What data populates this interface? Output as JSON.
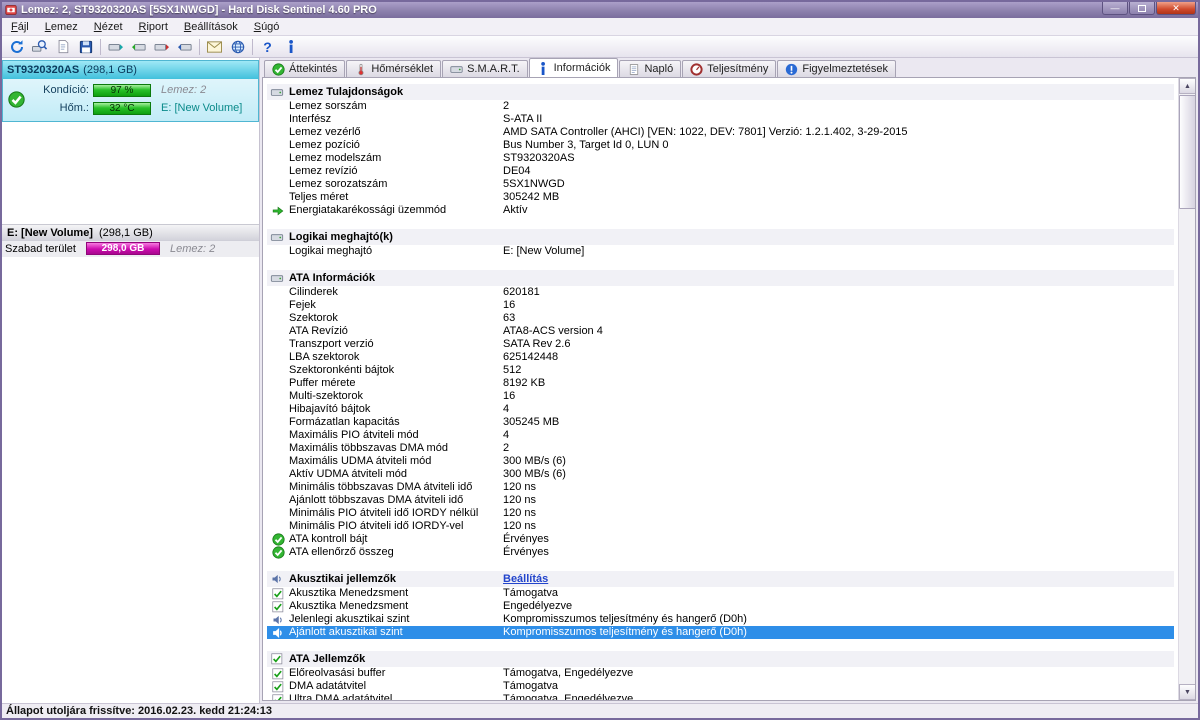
{
  "window": {
    "title": "Lemez: 2, ST9320320AS [5SX1NWGD] -  Hard Disk Sentinel 4.60 PRO",
    "status": "Állapot utoljára frissítve: 2016.02.23. kedd 21:24:13"
  },
  "menu": {
    "items": [
      "Fájl",
      "Lemez",
      "Nézet",
      "Riport",
      "Beállítások",
      "Súgó"
    ]
  },
  "toolbar": {
    "items": [
      {
        "name": "refresh-icon",
        "icon": "refresh"
      },
      {
        "name": "quick-test-icon",
        "icon": "magnifier"
      },
      {
        "name": "report-icon",
        "icon": "page"
      },
      {
        "name": "save-icon",
        "icon": "save"
      },
      {
        "sep": true
      },
      {
        "name": "first-disk-icon",
        "icon": "disk-teal"
      },
      {
        "name": "prev-disk-icon",
        "icon": "disk-green"
      },
      {
        "name": "next-disk-icon",
        "icon": "disk-red"
      },
      {
        "name": "last-disk-icon",
        "icon": "disk-blue"
      },
      {
        "sep": true
      },
      {
        "name": "send-mail-icon",
        "icon": "mail"
      },
      {
        "name": "website-icon",
        "icon": "globe"
      },
      {
        "sep": true
      },
      {
        "name": "help-icon",
        "icon": "help"
      },
      {
        "name": "about-icon",
        "icon": "info-i"
      }
    ]
  },
  "sidebar": {
    "disk": {
      "name": "ST9320320AS",
      "size": "(298,1 GB)",
      "condition_label": "Kondíció:",
      "condition_value": "97 %",
      "condition_extra": "Lemez: 2",
      "temp_label": "Hőm.:",
      "temp_value": "32 °C",
      "temp_extra": "E: [New Volume]"
    },
    "partition": {
      "name": "E: [New Volume]",
      "size": "(298,1 GB)",
      "free_label": "Szabad terület",
      "free_value": "298,0 GB",
      "free_extra": "Lemez: 2"
    }
  },
  "tabs": [
    {
      "name": "tab-overview",
      "label": "Áttekintés",
      "icon": "check-circle",
      "active": false
    },
    {
      "name": "tab-temperature",
      "label": "Hőmérséklet",
      "icon": "thermometer",
      "active": false
    },
    {
      "name": "tab-smart",
      "label": "S.M.A.R.T.",
      "icon": "disk",
      "active": false
    },
    {
      "name": "tab-information",
      "label": "Információk",
      "icon": "info-i",
      "active": true
    },
    {
      "name": "tab-log",
      "label": "Napló",
      "icon": "log-page",
      "active": false
    },
    {
      "name": "tab-performance",
      "label": "Teljesítmény",
      "icon": "gauge",
      "active": false
    },
    {
      "name": "tab-alerts",
      "label": "Figyelmeztetések",
      "icon": "alert",
      "active": false
    }
  ],
  "content": {
    "sections": [
      {
        "title": "Lemez Tulajdonságok",
        "icon": "disk",
        "rows": [
          {
            "label": "Lemez sorszám",
            "value": "2"
          },
          {
            "label": "Interfész",
            "value": "S-ATA II"
          },
          {
            "label": "Lemez vezérlő",
            "value": "AMD SATA Controller (AHCI) [VEN: 1022, DEV: 7801] Verzió: 1.2.1.402, 3-29-2015"
          },
          {
            "label": "Lemez pozíció",
            "value": "Bus Number 3, Target Id 0, LUN 0"
          },
          {
            "label": "Lemez modelszám",
            "value": "ST9320320AS"
          },
          {
            "label": "Lemez revízió",
            "value": "DE04"
          },
          {
            "label": "Lemez sorozatszám",
            "value": "5SX1NWGD"
          },
          {
            "label": "Teljes méret",
            "value": "305242 MB"
          },
          {
            "label": "Energiatakarékossági üzemmód",
            "value": "Aktív",
            "icon": "green-arrow"
          }
        ]
      },
      {
        "title": "Logikai meghajtó(k)",
        "icon": "disk",
        "rows": [
          {
            "label": "Logikai meghajtó",
            "value": "E: [New Volume]"
          }
        ]
      },
      {
        "title": "ATA Információk",
        "icon": "disk",
        "rows": [
          {
            "label": "Cilinderek",
            "value": "620181"
          },
          {
            "label": "Fejek",
            "value": "16"
          },
          {
            "label": "Szektorok",
            "value": "63"
          },
          {
            "label": "ATA Revízió",
            "value": "ATA8-ACS version 4"
          },
          {
            "label": "Transzport verzió",
            "value": "SATA Rev 2.6"
          },
          {
            "label": "LBA szektorok",
            "value": "625142448"
          },
          {
            "label": "Szektoronkénti bájtok",
            "value": "512"
          },
          {
            "label": "Puffer mérete",
            "value": "8192 KB"
          },
          {
            "label": "Multi-szektorok",
            "value": "16"
          },
          {
            "label": "Hibajavító bájtok",
            "value": "4"
          },
          {
            "label": "Formázatlan kapacitás",
            "value": "305245 MB"
          },
          {
            "label": "Maximális PIO átviteli mód",
            "value": "4"
          },
          {
            "label": "Maximális többszavas DMA mód",
            "value": "2"
          },
          {
            "label": "Maximális UDMA átviteli mód",
            "value": "300 MB/s (6)"
          },
          {
            "label": "Aktív UDMA átviteli mód",
            "value": "300 MB/s (6)"
          },
          {
            "label": "Minimális többszavas DMA átviteli idő",
            "value": "120 ns"
          },
          {
            "label": "Ajánlott többszavas DMA átviteli idő",
            "value": "120 ns"
          },
          {
            "label": "Minimális PIO átviteli idő IORDY nélkül",
            "value": "120 ns"
          },
          {
            "label": "Minimális PIO átviteli idő IORDY-vel",
            "value": "120 ns"
          },
          {
            "label": "ATA kontroll bájt",
            "value": "Érvényes",
            "icon": "check-circle"
          },
          {
            "label": "ATA ellenőrző összeg",
            "value": "Érvényes",
            "icon": "check-circle"
          }
        ]
      },
      {
        "title": "Akusztikai jellemzők",
        "icon": "speaker",
        "link": "Beállítás",
        "rows": [
          {
            "label": "Akusztika Menedzsment",
            "value": "Támogatva",
            "icon": "checkbox"
          },
          {
            "label": "Akusztika Menedzsment",
            "value": "Engedélyezve",
            "icon": "checkbox"
          },
          {
            "label": "Jelenlegi akusztikai szint",
            "value": "Kompromisszumos teljesítmény és hangerő (D0h)",
            "icon": "speaker"
          },
          {
            "label": "Ajánlott akusztikai szint",
            "value": "Kompromisszumos teljesítmény és hangerő (D0h)",
            "icon": "speaker",
            "selected": true
          }
        ]
      },
      {
        "title": "ATA Jellemzők",
        "icon": "checkbox",
        "rows": [
          {
            "label": "Előreolvasási buffer",
            "value": "Támogatva, Engedélyezve",
            "icon": "checkbox"
          },
          {
            "label": "DMA adatátvitel",
            "value": "Támogatva",
            "icon": "checkbox"
          },
          {
            "label": "Ultra DMA adatátvitel",
            "value": "Támogatva, Engedélyezve",
            "icon": "checkbox"
          }
        ]
      }
    ]
  }
}
